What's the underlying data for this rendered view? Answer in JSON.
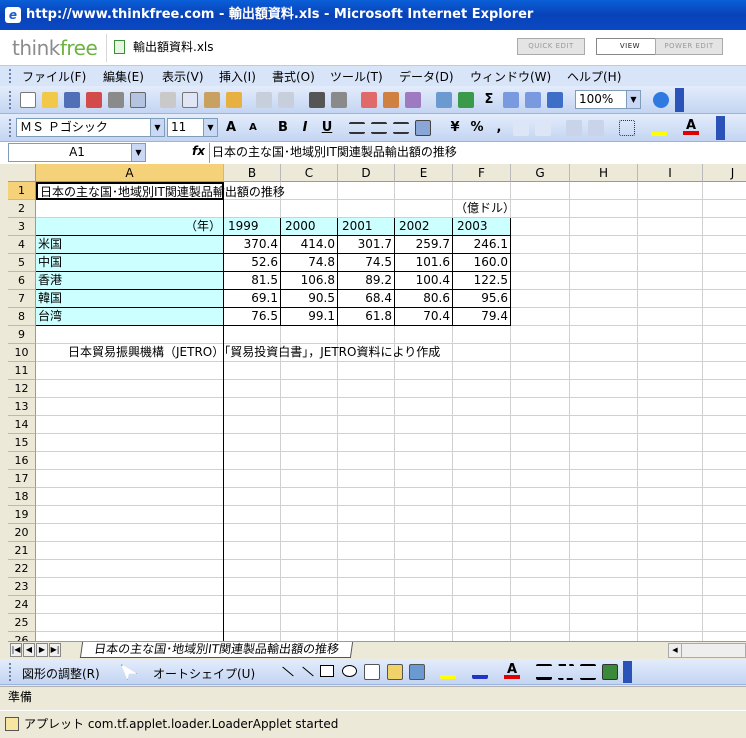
{
  "window": {
    "title": "http://www.thinkfree.com - 輸出額資料.xls - Microsoft Internet Explorer"
  },
  "app": {
    "logo_think": "think",
    "logo_free": "free",
    "filename": "輸出額資料.xls",
    "modes": [
      "QUICK EDIT",
      "VIEW",
      "POWER EDIT"
    ]
  },
  "menu": [
    "ファイル(F)",
    "編集(E)",
    "表示(V)",
    "挿入(I)",
    "書式(O)",
    "ツール(T)",
    "データ(D)",
    "ウィンドウ(W)",
    "ヘルプ(H)"
  ],
  "toolbar": {
    "zoom": "100%",
    "sigma": "Σ"
  },
  "format": {
    "font": "ＭＳ Ｐゴシック",
    "size": "11",
    "bold": "B",
    "italic": "I",
    "underline": "U",
    "yen": "¥",
    "percent": "%",
    "comma": ","
  },
  "formula_bar": {
    "cell_ref": "A1",
    "fx": "fx",
    "content": "日本の主な国･地域別IT関連製品輸出額の推移"
  },
  "columns": [
    "A",
    "B",
    "C",
    "D",
    "E",
    "F",
    "G",
    "H",
    "I",
    "J"
  ],
  "rows": [
    "1",
    "2",
    "3",
    "4",
    "5",
    "6",
    "7",
    "8",
    "9",
    "10",
    "11",
    "12",
    "13",
    "14",
    "15",
    "16",
    "17",
    "18",
    "19",
    "20",
    "21",
    "22",
    "23",
    "24",
    "25",
    "26"
  ],
  "sheet": {
    "a1": "日本の主な国･地域別IT関連製品輸出額の推移",
    "f2": "（億ドル）",
    "a3": "（年）",
    "years": [
      "1999",
      "2000",
      "2001",
      "2002",
      "2003"
    ],
    "data": [
      {
        "country": "米国",
        "values": [
          "370.4",
          "414.0",
          "301.7",
          "259.7",
          "246.1"
        ]
      },
      {
        "country": "中国",
        "values": [
          "52.6",
          "74.8",
          "74.5",
          "101.6",
          "160.0"
        ]
      },
      {
        "country": "香港",
        "values": [
          "81.5",
          "106.8",
          "89.2",
          "100.4",
          "122.5"
        ]
      },
      {
        "country": "韓国",
        "values": [
          "69.1",
          "90.5",
          "68.4",
          "80.6",
          "95.6"
        ]
      },
      {
        "country": "台湾",
        "values": [
          "76.5",
          "99.1",
          "61.8",
          "70.4",
          "79.4"
        ]
      }
    ],
    "a10": "日本貿易振興機構（JETRO）「貿易投資白書」，JETRO資料により作成"
  },
  "sheet_tab": "日本の主な国･地域別IT関連製品輸出額の推移",
  "drawing": {
    "adjust": "図形の調整(R)",
    "autoshape": "オートシェイプ(U)"
  },
  "status": "準備",
  "ie_status": "アプレット com.tf.applet.loader.LoaderApplet started"
}
